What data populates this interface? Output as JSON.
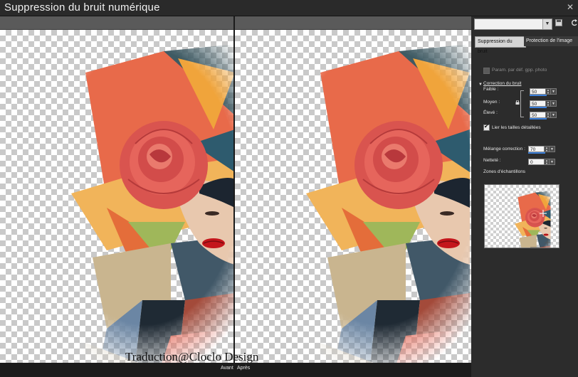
{
  "window": {
    "title": "Suppression du bruit numérique"
  },
  "preview": {
    "left_label": "Avant",
    "right_label": "Après",
    "watermark": "Traduction@Cloclo Design"
  },
  "panel": {
    "tabs": [
      "Suppression du bruit",
      "Protection de l'image"
    ],
    "preset_value": "",
    "camera_defaults_label": "Param. par déf. gpp. photo",
    "noise_correction": {
      "heading": "Correction du bruit",
      "rows": [
        {
          "label": "Faible :",
          "value": "50"
        },
        {
          "label": "Moyen :",
          "value": "50"
        },
        {
          "label": "Élevé :",
          "value": "50"
        }
      ]
    },
    "link_sizes_label": "Lier les tailles détaillées",
    "mix": {
      "label": "Mélange correction :",
      "value": "70"
    },
    "sharpness": {
      "label": "Netteté :",
      "value": "0"
    },
    "samples_label": "Zones d'échantillons"
  },
  "colors": {
    "accent": "#3b7fd9",
    "panel_bg": "#2c2c2c",
    "checker": "#c9c9c9"
  }
}
